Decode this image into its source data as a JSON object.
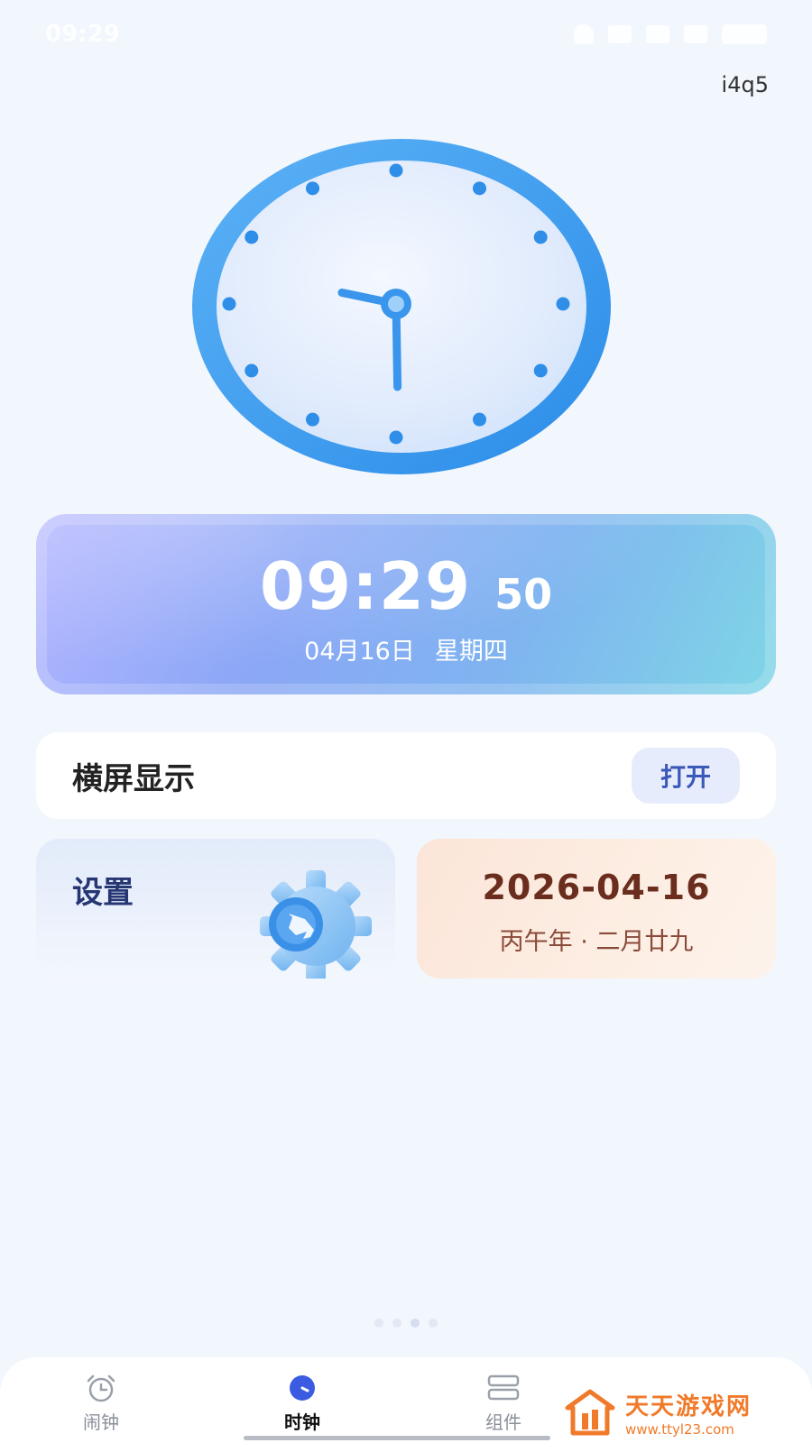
{
  "status_bar": {
    "time": "09:29"
  },
  "corner_label": "i4q5",
  "analog_clock": {
    "hour": 9,
    "minute": 29,
    "second": 50
  },
  "time_card": {
    "time": "09:29",
    "seconds": "50",
    "date": "04月16日",
    "weekday": "星期四"
  },
  "landscape": {
    "label": "横屏显示",
    "button_label": "打开"
  },
  "settings_card": {
    "label": "设置"
  },
  "calendar_card": {
    "date": "2026-04-16",
    "lunar": "丙午年 · 二月廿九"
  },
  "tab_bar": {
    "tabs": [
      {
        "label": "闹钟",
        "icon": "alarm-clock-icon",
        "active": false
      },
      {
        "label": "时钟",
        "icon": "clock-icon",
        "active": true
      },
      {
        "label": "组件",
        "icon": "widgets-icon",
        "active": false
      }
    ]
  },
  "watermark": {
    "title": "天天游戏网",
    "url": "www.ttyl23.com"
  },
  "colors": {
    "clock_ring": "#3d9cf0",
    "accent_blue": "#3c59b8",
    "calendar_text": "#6b2e1e",
    "watermark": "#f07a2a"
  }
}
